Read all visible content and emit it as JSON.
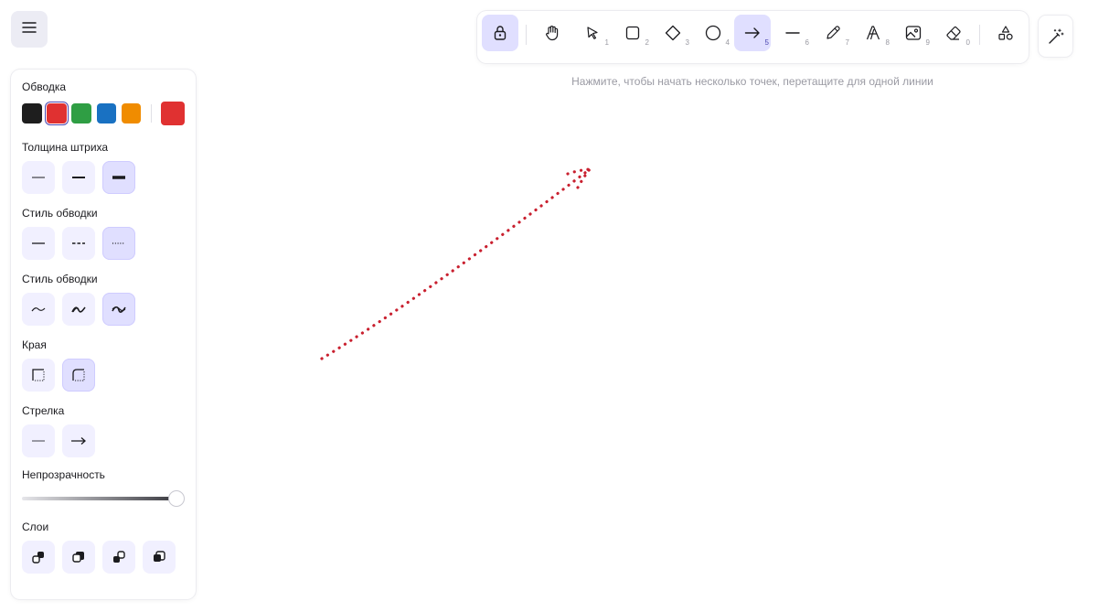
{
  "menu": {
    "icon": "hamburger-icon"
  },
  "panel": {
    "stroke": {
      "label": "Обводка",
      "swatches": [
        "#1e1e1e",
        "#e03131",
        "#2f9e44",
        "#1971c2",
        "#f08c00"
      ],
      "selected": "#e03131",
      "current": "#e03131"
    },
    "stroke_width": {
      "label": "Толщина штриха",
      "options": [
        "thin",
        "bold",
        "extra-bold"
      ],
      "selected": "extra-bold"
    },
    "stroke_style": {
      "label": "Стиль обводки",
      "options": [
        "solid",
        "dashed",
        "dotted"
      ],
      "selected": "dotted"
    },
    "sloppiness": {
      "label": "Стиль обводки",
      "options": [
        "architect",
        "artist",
        "cartoonist"
      ],
      "selected": "cartoonist"
    },
    "edges": {
      "label": "Края",
      "options": [
        "sharp",
        "round"
      ],
      "selected": "round"
    },
    "arrowhead": {
      "label": "Стрелка",
      "options": [
        "none",
        "arrow"
      ]
    },
    "opacity": {
      "label": "Непрозрачность",
      "value": 100
    },
    "layers": {
      "label": "Слои",
      "options": [
        "send-to-back",
        "send-backward",
        "bring-forward",
        "bring-to-front"
      ]
    }
  },
  "toolbar": {
    "tools": [
      {
        "name": "lock",
        "key": ""
      },
      {
        "name": "hand",
        "key": ""
      },
      {
        "name": "selection",
        "key": "1"
      },
      {
        "name": "rectangle",
        "key": "2"
      },
      {
        "name": "diamond",
        "key": "3"
      },
      {
        "name": "ellipse",
        "key": "4"
      },
      {
        "name": "arrow",
        "key": "5"
      },
      {
        "name": "line",
        "key": "6"
      },
      {
        "name": "freedraw",
        "key": "7"
      },
      {
        "name": "text",
        "key": "8"
      },
      {
        "name": "image",
        "key": "9"
      },
      {
        "name": "eraser",
        "key": "0"
      },
      {
        "name": "more-tools",
        "key": ""
      }
    ],
    "active": [
      "lock",
      "arrow"
    ]
  },
  "hint": "Нажмите, чтобы начать несколько точек, перетащите для одной линии",
  "canvas": {
    "arrow_color": "#c9202f",
    "arrow_style": "dotted"
  }
}
